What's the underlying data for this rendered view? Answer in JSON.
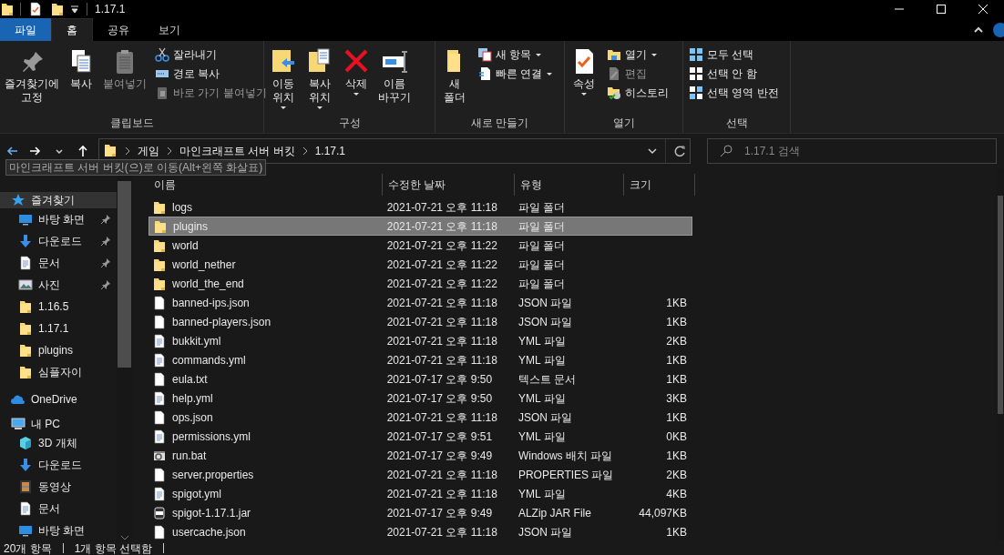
{
  "window": {
    "title": "1.17.1"
  },
  "ribbon_tabs": [
    {
      "label": "파일",
      "kind": "file",
      "selected": false
    },
    {
      "label": "홈",
      "kind": "tab",
      "selected": true
    },
    {
      "label": "공유",
      "kind": "tab",
      "selected": false
    },
    {
      "label": "보기",
      "kind": "tab",
      "selected": false
    }
  ],
  "ribbon_groups": [
    {
      "label": "클립보드",
      "large": [
        {
          "label": "즐겨찾기에\n고정",
          "disabled": false,
          "dropdown": false
        },
        {
          "label": "복사",
          "disabled": false,
          "dropdown": false
        },
        {
          "label": "붙여넣기",
          "disabled": true,
          "dropdown": false
        }
      ],
      "small": [
        {
          "label": "잘라내기",
          "disabled": false,
          "dropdown": false
        },
        {
          "label": "경로 복사",
          "disabled": false,
          "dropdown": false
        },
        {
          "label": "바로 가기 붙여넣기",
          "disabled": true,
          "dropdown": false
        }
      ]
    },
    {
      "label": "구성",
      "large": [
        {
          "label": "이동\n위치",
          "disabled": false,
          "dropdown": true
        },
        {
          "label": "복사\n위치",
          "disabled": false,
          "dropdown": true
        },
        {
          "label": "삭제",
          "disabled": false,
          "dropdown": true
        },
        {
          "label": "이름\n바꾸기",
          "disabled": false,
          "dropdown": false
        }
      ]
    },
    {
      "label": "새로 만들기",
      "large": [
        {
          "label": "새\n폴더",
          "disabled": false,
          "dropdown": false
        }
      ],
      "small": [
        {
          "label": "새 항목",
          "disabled": false,
          "dropdown": true
        },
        {
          "label": "빠른 연결",
          "disabled": false,
          "dropdown": true
        }
      ]
    },
    {
      "label": "열기",
      "large": [
        {
          "label": "속성",
          "disabled": false,
          "dropdown": true
        }
      ],
      "small": [
        {
          "label": "열기",
          "disabled": false,
          "dropdown": true
        },
        {
          "label": "편집",
          "disabled": true,
          "dropdown": false
        },
        {
          "label": "히스토리",
          "disabled": false,
          "dropdown": false
        }
      ]
    },
    {
      "label": "선택",
      "small": [
        {
          "label": "모두 선택",
          "disabled": false,
          "dropdown": false
        },
        {
          "label": "선택 안 함",
          "disabled": false,
          "dropdown": false
        },
        {
          "label": "선택 영역 반전",
          "disabled": false,
          "dropdown": false
        }
      ]
    }
  ],
  "breadcrumb": [
    "게임",
    "마인크래프트 서버 버킷",
    "1.17.1"
  ],
  "search": {
    "placeholder": "1.17.1 검색"
  },
  "tooltip": "마인크래프트 서버 버킷(으)로 이동(Alt+왼쪽 화살표)",
  "sidebar": {
    "items": [
      {
        "label": "즐겨찾기",
        "kind": "star",
        "selected": true,
        "children": [
          {
            "label": "바탕 화면",
            "kind": "desktop",
            "pinned": true,
            "selected": false
          },
          {
            "label": "다운로드",
            "kind": "download",
            "pinned": true,
            "selected": false
          },
          {
            "label": "문서",
            "kind": "doc",
            "pinned": true,
            "selected": false
          },
          {
            "label": "사진",
            "kind": "photo",
            "pinned": true,
            "selected": false
          },
          {
            "label": "1.16.5",
            "kind": "folder",
            "pinned": false,
            "selected": false
          },
          {
            "label": "1.17.1",
            "kind": "folder",
            "pinned": false,
            "selected": false
          },
          {
            "label": "plugins",
            "kind": "folder",
            "pinned": false,
            "selected": false
          },
          {
            "label": "심플자이",
            "kind": "folder",
            "pinned": false,
            "selected": false
          }
        ]
      },
      {
        "label": "OneDrive",
        "kind": "cloud",
        "selected": false
      },
      {
        "label": "내 PC",
        "kind": "pc",
        "selected": false,
        "children": [
          {
            "label": "3D 개체",
            "kind": "cube",
            "pinned": false,
            "selected": false
          },
          {
            "label": "다운로드",
            "kind": "download",
            "pinned": false,
            "selected": false
          },
          {
            "label": "동영상",
            "kind": "video",
            "pinned": false,
            "selected": false
          },
          {
            "label": "문서",
            "kind": "doc",
            "pinned": false,
            "selected": false
          },
          {
            "label": "바탕 화면",
            "kind": "desktop",
            "pinned": false,
            "selected": false
          }
        ]
      }
    ]
  },
  "table": {
    "columns": [
      "이름",
      "수정한 날짜",
      "유형",
      "크기"
    ],
    "rows": [
      {
        "kind": "folder",
        "name": "logs",
        "date": "2021-07-21 오후 11:18",
        "type": "파일 폴더",
        "size": "",
        "selected": false
      },
      {
        "kind": "folder",
        "name": "plugins",
        "date": "2021-07-21 오후 11:18",
        "type": "파일 폴더",
        "size": "",
        "selected": true
      },
      {
        "kind": "folder",
        "name": "world",
        "date": "2021-07-21 오후 11:22",
        "type": "파일 폴더",
        "size": "",
        "selected": false
      },
      {
        "kind": "folder",
        "name": "world_nether",
        "date": "2021-07-21 오후 11:22",
        "type": "파일 폴더",
        "size": "",
        "selected": false
      },
      {
        "kind": "folder",
        "name": "world_the_end",
        "date": "2021-07-21 오후 11:22",
        "type": "파일 폴더",
        "size": "",
        "selected": false
      },
      {
        "kind": "file",
        "name": "banned-ips.json",
        "date": "2021-07-21 오후 11:18",
        "type": "JSON 파일",
        "size": "1KB",
        "selected": false
      },
      {
        "kind": "file",
        "name": "banned-players.json",
        "date": "2021-07-21 오후 11:18",
        "type": "JSON 파일",
        "size": "1KB",
        "selected": false
      },
      {
        "kind": "yml",
        "name": "bukkit.yml",
        "date": "2021-07-21 오후 11:18",
        "type": "YML 파일",
        "size": "2KB",
        "selected": false
      },
      {
        "kind": "yml",
        "name": "commands.yml",
        "date": "2021-07-21 오후 11:18",
        "type": "YML 파일",
        "size": "1KB",
        "selected": false
      },
      {
        "kind": "file",
        "name": "eula.txt",
        "date": "2021-07-17 오후 9:50",
        "type": "텍스트 문서",
        "size": "1KB",
        "selected": false
      },
      {
        "kind": "yml",
        "name": "help.yml",
        "date": "2021-07-17 오후 9:50",
        "type": "YML 파일",
        "size": "3KB",
        "selected": false
      },
      {
        "kind": "file",
        "name": "ops.json",
        "date": "2021-07-21 오후 11:18",
        "type": "JSON 파일",
        "size": "1KB",
        "selected": false
      },
      {
        "kind": "yml",
        "name": "permissions.yml",
        "date": "2021-07-17 오후 9:51",
        "type": "YML 파일",
        "size": "0KB",
        "selected": false
      },
      {
        "kind": "bat",
        "name": "run.bat",
        "date": "2021-07-17 오후 9:49",
        "type": "Windows 배치 파일",
        "size": "1KB",
        "selected": false
      },
      {
        "kind": "file",
        "name": "server.properties",
        "date": "2021-07-21 오후 11:18",
        "type": "PROPERTIES 파일",
        "size": "2KB",
        "selected": false
      },
      {
        "kind": "yml",
        "name": "spigot.yml",
        "date": "2021-07-21 오후 11:18",
        "type": "YML 파일",
        "size": "4KB",
        "selected": false
      },
      {
        "kind": "jar",
        "name": "spigot-1.17.1.jar",
        "date": "2021-07-17 오후 9:49",
        "type": "ALZip JAR File",
        "size": "44,097KB",
        "selected": false
      },
      {
        "kind": "file",
        "name": "usercache.json",
        "date": "2021-07-21 오후 11:18",
        "type": "JSON 파일",
        "size": "1KB",
        "selected": false
      }
    ]
  },
  "status_bar": [
    "20개 항목",
    "1개 항목 선택함"
  ]
}
